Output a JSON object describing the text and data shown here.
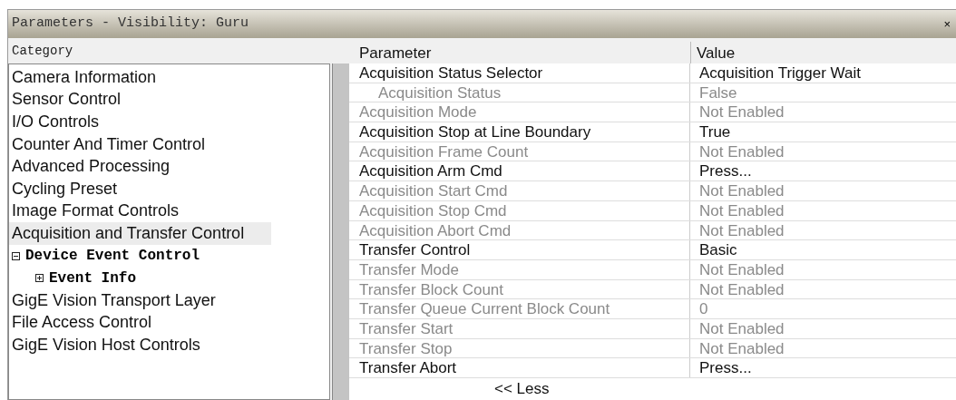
{
  "window": {
    "title": "Parameters - Visibility: Guru",
    "close": "×"
  },
  "category_panel": {
    "header": "Category",
    "items": [
      {
        "label": "Camera Information",
        "selected": false
      },
      {
        "label": "Sensor Control",
        "selected": false
      },
      {
        "label": "I/O Controls",
        "selected": false
      },
      {
        "label": "Counter And Timer Control",
        "selected": false
      },
      {
        "label": "Advanced Processing",
        "selected": false
      },
      {
        "label": "Cycling Preset",
        "selected": false
      },
      {
        "label": "Image Format Controls",
        "selected": false
      },
      {
        "label": "Acquisition and Transfer Control",
        "selected": true
      },
      {
        "label": "Device Event Control",
        "selected": false,
        "expanded": true,
        "children": [
          {
            "label": "Event Info",
            "selected": false,
            "expanded": false
          }
        ]
      },
      {
        "label": "GigE Vision Transport Layer",
        "selected": false
      },
      {
        "label": "File Access Control",
        "selected": false
      },
      {
        "label": "GigE Vision Host Controls",
        "selected": false
      }
    ]
  },
  "parameter_table": {
    "columns": [
      "Parameter",
      "Value"
    ],
    "rows": [
      {
        "parameter": "Acquisition Status Selector",
        "value": "Acquisition Trigger Wait",
        "enabled": true,
        "children": [
          {
            "parameter": "Acquisition Status",
            "value": "False",
            "enabled": false
          }
        ]
      },
      {
        "parameter": "Acquisition Mode",
        "value": "Not Enabled",
        "enabled": false
      },
      {
        "parameter": "Acquisition Stop at Line Boundary",
        "value": "True",
        "enabled": true
      },
      {
        "parameter": "Acquisition Frame Count",
        "value": "Not Enabled",
        "enabled": false
      },
      {
        "parameter": "Acquisition Arm Cmd",
        "value": "Press...",
        "enabled": true
      },
      {
        "parameter": "Acquisition Start Cmd",
        "value": "Not Enabled",
        "enabled": false
      },
      {
        "parameter": "Acquisition Stop Cmd",
        "value": "Not Enabled",
        "enabled": false
      },
      {
        "parameter": "Acquisition Abort Cmd",
        "value": "Not Enabled",
        "enabled": false
      },
      {
        "parameter": "Transfer Control",
        "value": "Basic",
        "enabled": true
      },
      {
        "parameter": "Transfer Mode",
        "value": "Not Enabled",
        "enabled": false
      },
      {
        "parameter": "Transfer Block Count",
        "value": "Not Enabled",
        "enabled": false
      },
      {
        "parameter": "Transfer Queue Current Block Count",
        "value": "0",
        "enabled": false
      },
      {
        "parameter": "Transfer Start",
        "value": "Not Enabled",
        "enabled": false
      },
      {
        "parameter": "Transfer Stop",
        "value": "Not Enabled",
        "enabled": false
      },
      {
        "parameter": "Transfer Abort",
        "value": "Press...",
        "enabled": true
      }
    ],
    "toggle": "<< Less"
  }
}
